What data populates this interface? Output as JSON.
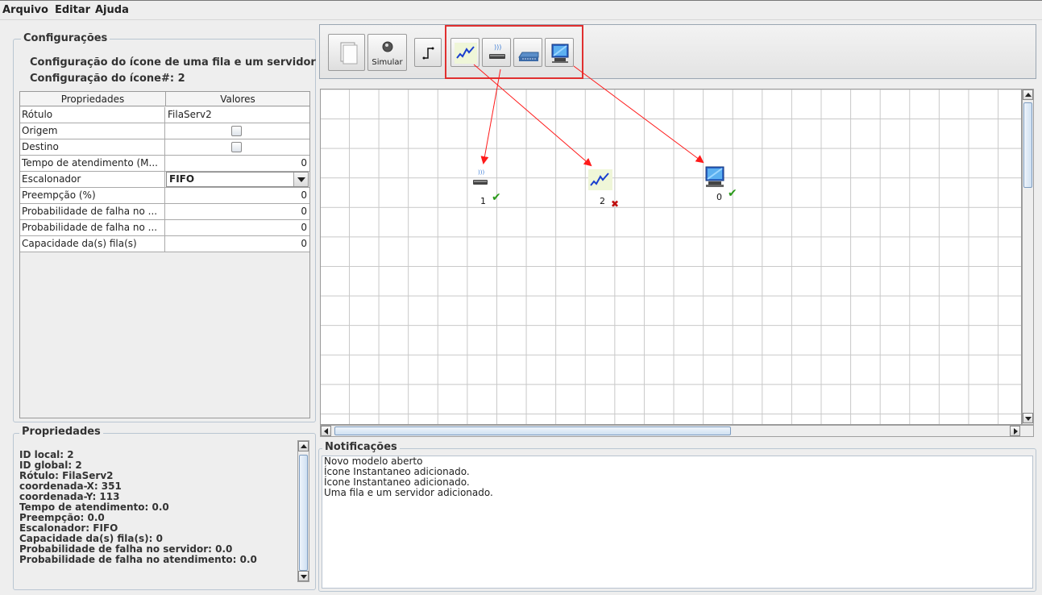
{
  "menu": [
    "Arquivo",
    "Editar",
    "Ajuda"
  ],
  "config": {
    "title": "Configurações",
    "heading": "Configuração do ícone de uma fila e um servidor",
    "icon_number": "Configuração do ícone#: 2"
  },
  "table": {
    "col1": "Propriedades",
    "col2": "Valores",
    "rows": [
      {
        "label": "Rótulo",
        "value": "FilaServ2"
      },
      {
        "label": "Origem",
        "value": ""
      },
      {
        "label": "Destino",
        "value": ""
      },
      {
        "label": "Tempo de atendimento (M...",
        "value": "0"
      },
      {
        "label": "Escalonador",
        "value": "FIFO"
      },
      {
        "label": "Preempção (%)",
        "value": "0"
      },
      {
        "label": "Probabilidade de falha no ...",
        "value": "0"
      },
      {
        "label": "Probabilidade de falha no ...",
        "value": "0"
      },
      {
        "label": "Capacidade da(s) fila(s)",
        "value": "0"
      }
    ]
  },
  "properties": {
    "title": "Propriedades",
    "lines": [
      "ID local: 2",
      "ID global: 2",
      "Rótulo: FilaServ2",
      "coordenada-X: 351",
      "coordenada-Y: 113",
      "Tempo de atendimento: 0.0",
      "Preempção: 0.0",
      "Escalonador: FIFO",
      "Capacidade da(s) fila(s): 0",
      "Probabilidade de falha no servidor: 0.0",
      "Probabilidade de falha no atendimento: 0.0"
    ]
  },
  "toolbar": {
    "simulate_label": "Simular"
  },
  "canvas": {
    "nodes": [
      {
        "id": "1",
        "icon": "router-icon",
        "status": "ok"
      },
      {
        "id": "2",
        "icon": "queue-server-icon",
        "status": "error"
      },
      {
        "id": "0",
        "icon": "computer-icon",
        "status": "ok"
      }
    ]
  },
  "notifications": {
    "title": "Notificações",
    "lines": [
      "Novo modelo aberto",
      "Ícone Instantaneo adicionado.",
      "Ícone Instantaneo adicionado.",
      "Uma fila e um servidor adicionado."
    ]
  },
  "colors": {
    "highlight_box": "#e03030",
    "ok": "#2a9a1a",
    "error": "#c01010"
  }
}
